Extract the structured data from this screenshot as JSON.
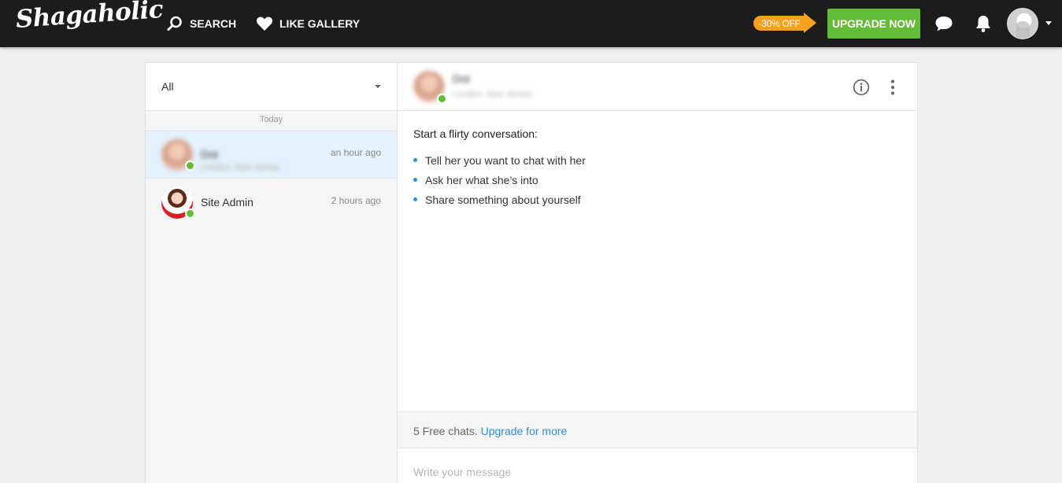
{
  "brand": {
    "name": "Shagaholic"
  },
  "nav": {
    "search_label": "SEARCH",
    "like_gallery_label": "LIKE GALLERY"
  },
  "promo": {
    "discount_label": "-30% OFF",
    "upgrade_label": "UPGRADE NOW"
  },
  "sidebar": {
    "filter_value": "All",
    "day_label": "Today",
    "conversations": [
      {
        "name": "Dot",
        "subtitle": "London, New Jersey",
        "time": "an hour ago",
        "active": true,
        "online": true
      },
      {
        "name": "Site Admin",
        "subtitle": "",
        "time": "2 hours ago",
        "active": false,
        "online": true
      }
    ]
  },
  "chat": {
    "header": {
      "name": "Dot",
      "subtitle": "London, New Jersey"
    },
    "prompt_title": "Start a flirty conversation:",
    "suggestions": [
      "Tell her you want to chat with her",
      "Ask her what she’s into",
      "Share something about yourself"
    ],
    "free_text": "5 Free chats.",
    "upgrade_link": "Upgrade for more",
    "input_placeholder": "Write your message"
  },
  "colors": {
    "topbar": "#1c1c1c",
    "upgrade_green": "#65bc36",
    "discount_orange": "#f6a11e",
    "link_blue": "#2d90d8",
    "active_row": "#e3f2fc"
  }
}
